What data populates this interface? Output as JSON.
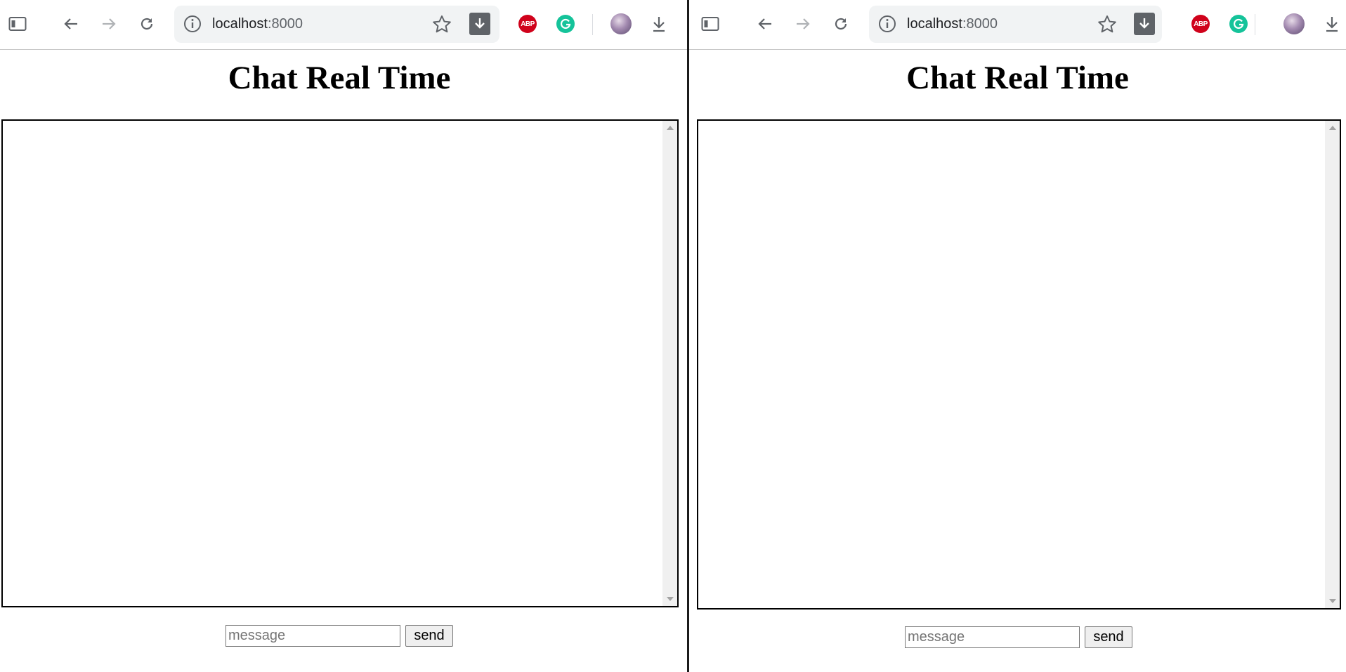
{
  "browser": {
    "url_host": "localhost",
    "url_port": ":8000"
  },
  "extensions": {
    "adblock_label": "ABP"
  },
  "page": {
    "title": "Chat Real Time",
    "message_placeholder": "message",
    "send_label": "send"
  },
  "colors": {
    "adblock": "#d0021b",
    "grammarly": "#15c39a",
    "omnibox_bg": "#f1f3f4",
    "icon": "#5f6368"
  }
}
